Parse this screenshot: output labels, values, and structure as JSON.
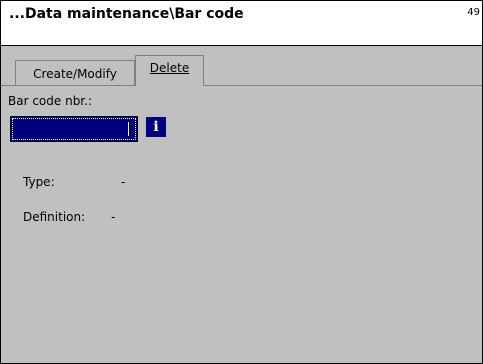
{
  "window": {
    "title": "...Data maintenance\\Bar code",
    "corner_number": "49"
  },
  "tabs": [
    {
      "label": "Create/Modify",
      "selected": false
    },
    {
      "label": "Delete",
      "selected": true
    }
  ],
  "form": {
    "barcode_label": "Bar code nbr.:",
    "barcode_value": "",
    "info_icon_glyph": "i",
    "type_label": "Type:",
    "type_value": "-",
    "definition_label": "Definition:",
    "definition_value": "-"
  }
}
